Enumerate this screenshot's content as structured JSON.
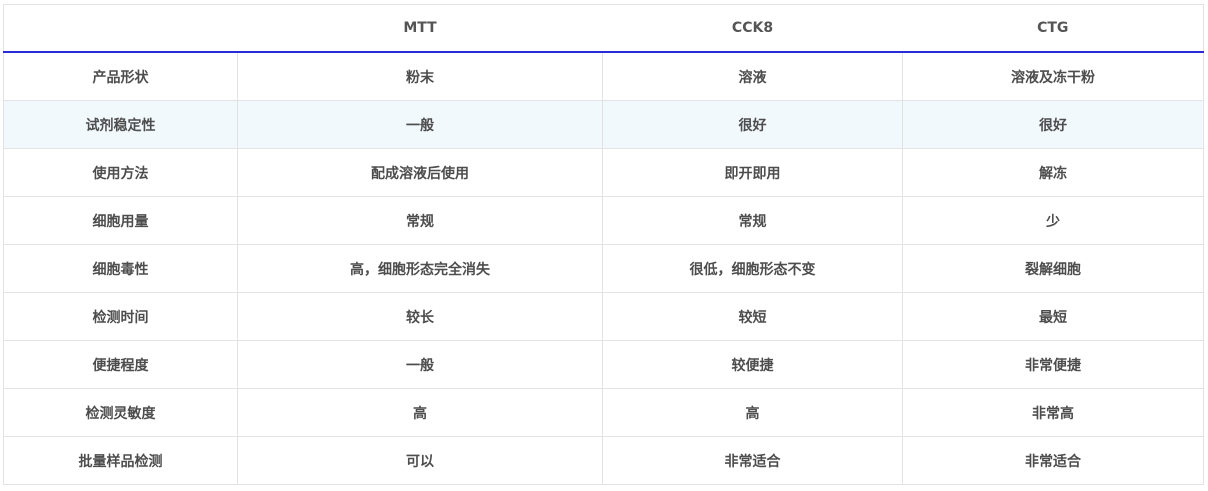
{
  "table": {
    "headers": [
      "",
      "MTT",
      "CCK8",
      "CTG"
    ],
    "rows": [
      [
        "产品形状",
        "粉末",
        "溶液",
        "溶液及冻干粉"
      ],
      [
        "试剂稳定性",
        "一般",
        "很好",
        "很好"
      ],
      [
        "使用方法",
        "配成溶液后使用",
        "即开即用",
        "解冻"
      ],
      [
        "细胞用量",
        "常规",
        "常规",
        "少"
      ],
      [
        "细胞毒性",
        "高，细胞形态完全消失",
        "很低，细胞形态不变",
        "裂解细胞"
      ],
      [
        "检测时间",
        "较长",
        "较短",
        "最短"
      ],
      [
        "便捷程度",
        "一般",
        "较便捷",
        "非常便捷"
      ],
      [
        "检测灵敏度",
        "高",
        "高",
        "非常高"
      ],
      [
        "批量样品检测",
        "可以",
        "非常适合",
        "非常适合"
      ]
    ],
    "highlighted_row": 1
  },
  "colors": {
    "header_rule": "#2a2ad6",
    "grid": "#e3e3e3",
    "highlight_row": "#f2f9fd",
    "text": "#4d4d4d"
  }
}
